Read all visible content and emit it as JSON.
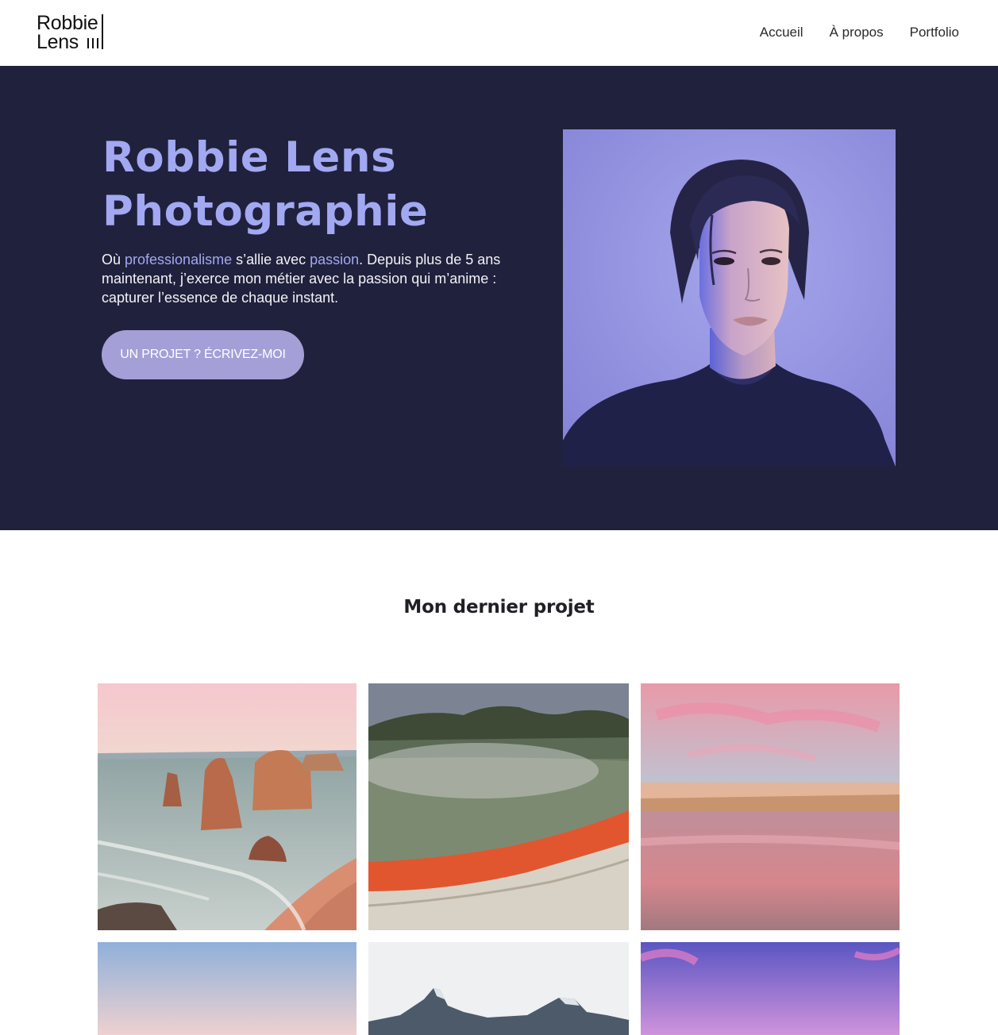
{
  "header": {
    "logo_line1": "Robbie",
    "logo_line2": "Lens",
    "nav": [
      "Accueil",
      "À propos",
      "Portfolio"
    ]
  },
  "hero": {
    "title_line1": "Robbie Lens",
    "title_line2": "Photographie",
    "text_prefix": "Où ",
    "highlight1": "professionalisme",
    "text_mid": " s’allie avec ",
    "highlight2": "passion",
    "text_suffix": ". Depuis plus de 5 ans maintenant, j’exerce mon métier avec la passion qui m’anime : capturer l’essence de chaque instant.",
    "cta_label": "UN PROJET ? ÉCRIVEZ-MOI"
  },
  "projects": {
    "title": "Mon dernier projet"
  },
  "colors": {
    "hero_bg": "#20213c",
    "accent": "#a2a8f1",
    "cta_bg": "#a49fd6"
  }
}
